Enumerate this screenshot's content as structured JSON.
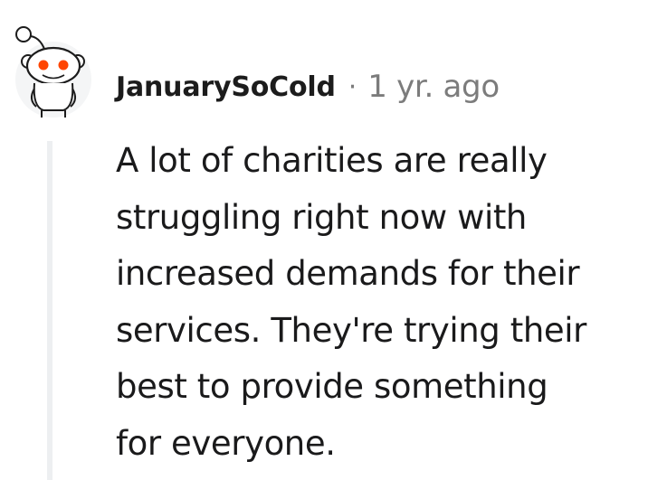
{
  "comment": {
    "author": "JanuarySoCold",
    "separator": "·",
    "timestamp": "1 yr. ago",
    "avatar_icon": "snoo-avatar-icon",
    "body_lines": [
      "A lot of charities are really",
      "struggling right now with",
      "increased demands for their",
      "services. They're trying their",
      "best to provide something",
      "for everyone."
    ]
  },
  "colors": {
    "username": "#1c1c1c",
    "meta": "#7c7c7c",
    "body_text": "#1a1a1b",
    "thread_line": "#edeff1",
    "snoo_eye": "#ff4500"
  }
}
